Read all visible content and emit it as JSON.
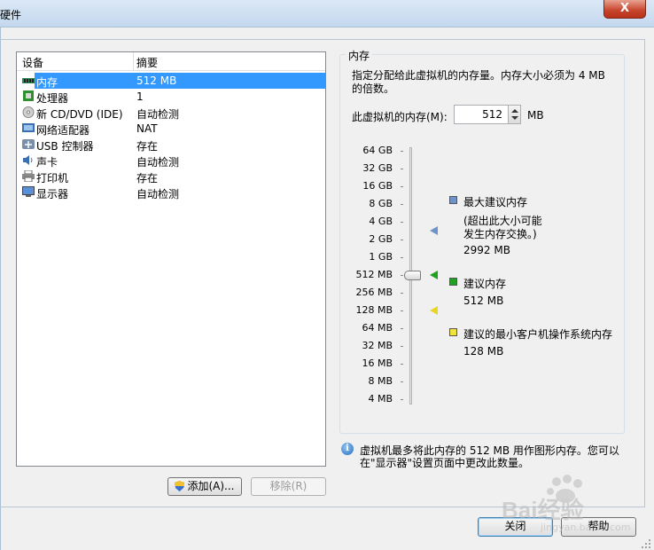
{
  "window": {
    "title": "硬件",
    "close_symbol": "X"
  },
  "device_list": {
    "headers": {
      "device": "设备",
      "summary": "摘要"
    },
    "rows": [
      {
        "name": "内存",
        "summary": "512 MB",
        "icon": "memory-icon"
      },
      {
        "name": "处理器",
        "summary": "1",
        "icon": "processor-icon"
      },
      {
        "name": "新 CD/DVD (IDE)",
        "summary": "自动检测",
        "icon": "cd-dvd-icon"
      },
      {
        "name": "网络适配器",
        "summary": "NAT",
        "icon": "network-adapter-icon"
      },
      {
        "name": "USB 控制器",
        "summary": "存在",
        "icon": "usb-icon"
      },
      {
        "name": "声卡",
        "summary": "自动检测",
        "icon": "sound-card-icon"
      },
      {
        "name": "打印机",
        "summary": "存在",
        "icon": "printer-icon"
      },
      {
        "name": "显示器",
        "summary": "自动检测",
        "icon": "display-icon"
      }
    ],
    "selected_index": 0
  },
  "buttons": {
    "add": "添加(A)...",
    "remove": "移除(R)",
    "close": "关闭",
    "help": "帮助"
  },
  "memory": {
    "group_title": "内存",
    "description_line1": "指定分配给此虚拟机的内存量。内存大小必须为 4 MB",
    "description_line2": "的倍数。",
    "input_label": "此虚拟机的内存(M):",
    "value": "512",
    "unit": "MB",
    "scale": [
      "64 GB",
      "32 GB",
      "16 GB",
      "8 GB",
      "4 GB",
      "2 GB",
      "1 GB",
      "512 MB",
      "256 MB",
      "128 MB",
      "64 MB",
      "32 MB",
      "16 MB",
      "8 MB",
      "4 MB"
    ],
    "current_level_index": 7,
    "legend": {
      "max": {
        "title": "最大建议内存",
        "note_line1": "(超出此大小可能",
        "note_line2": "发生内存交换。)",
        "value": "2992 MB",
        "color": "#6f93c8",
        "level_index": 4.5
      },
      "recommended": {
        "title": "建议内存",
        "value": "512 MB",
        "color": "#22a022",
        "level_index": 7
      },
      "minimum": {
        "title": "建议的最小客户机操作系统内存",
        "value": "128 MB",
        "color": "#f0e43a",
        "level_index": 9
      }
    },
    "info_line1": "虚拟机最多将此内存的 512 MB 用作图形内存。您可以",
    "info_line2": "在\"显示器\"设置页面中更改此数量。"
  },
  "watermark": {
    "text": "Bai经验",
    "subtext": "jingyan.baidu.com"
  }
}
